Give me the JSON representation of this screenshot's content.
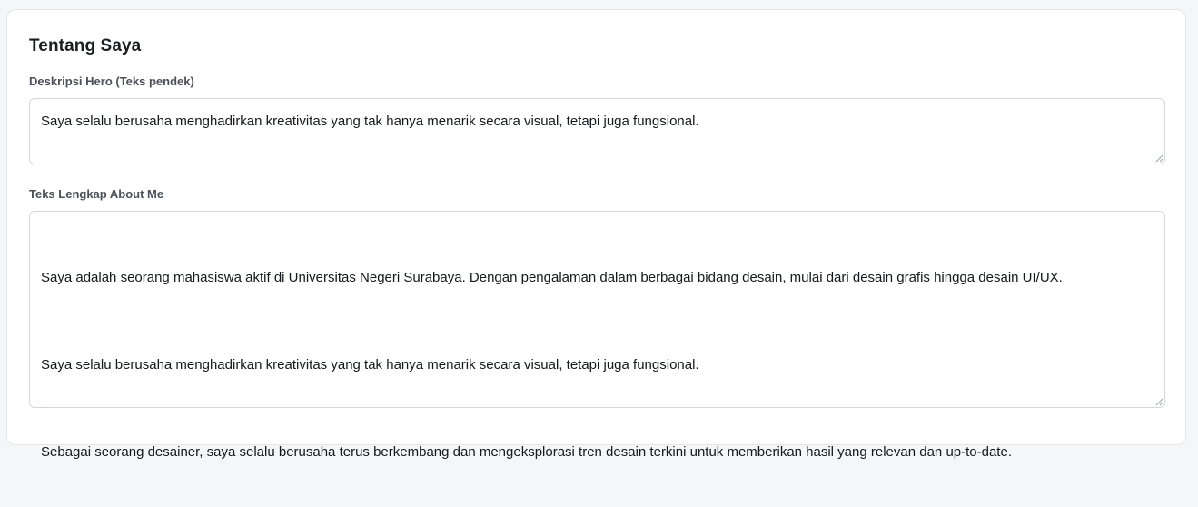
{
  "section": {
    "title": "Tentang Saya"
  },
  "hero_description": {
    "label": "Deskripsi Hero (Teks pendek)",
    "value": "Saya selalu berusaha menghadirkan kreativitas yang tak hanya menarik secara visual, tetapi juga fungsional."
  },
  "about_me": {
    "label": "Teks Lengkap About Me",
    "paragraphs": [
      "Saya adalah seorang mahasiswa aktif di Universitas Negeri Surabaya. Dengan pengalaman dalam berbagai bidang desain, mulai dari desain grafis hingga desain UI/UX.",
      "Saya selalu berusaha menghadirkan kreativitas yang tak hanya menarik secara visual, tetapi juga fungsional.",
      "Sebagai seorang desainer, saya selalu berusaha terus berkembang dan mengeksplorasi tren desain terkini untuk memberikan hasil yang relevan dan up-to-date."
    ]
  },
  "icons": {
    "resize": "resize-grip-icon"
  }
}
